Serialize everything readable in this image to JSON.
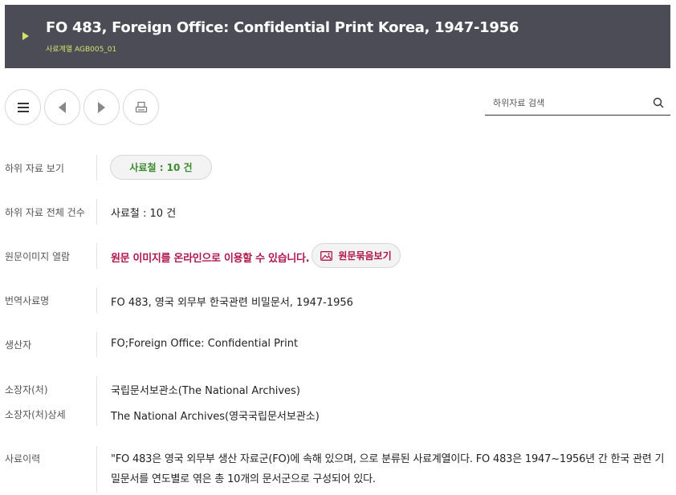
{
  "header": {
    "title": "FO 483, Foreign Office: Confidential Print Korea, 1947-1956",
    "subtitle": "사료계열 AGB005_01",
    "accent_color": "#d6e36b",
    "background_color": "#4c4c57"
  },
  "toolbar": {
    "menu_icon": "hamburger-menu-icon",
    "prev_icon": "triangle-left-icon",
    "next_icon": "triangle-right-icon",
    "print_icon": "print-icon"
  },
  "search": {
    "placeholder": "하위자료 검색",
    "value": "",
    "icon": "search-icon"
  },
  "fields": {
    "sub_items": {
      "label": "하위 자료 보기",
      "button": "사료철 : 10 건"
    },
    "total_count": {
      "label": "하위 자료 전체 건수",
      "value": "사료철 : 10 건"
    },
    "image_view": {
      "label": "원문이미지 열람",
      "notice": "원문 이미지를 온라인으로 이용할 수 있습니다.",
      "button": "원문묶음보기",
      "icon": "image-icon"
    },
    "translated_name": {
      "label": "번역사료명",
      "value": "FO 483, 영국 외무부 한국관련 비밀문서, 1947-1956"
    },
    "creator": {
      "label": "생산자",
      "value": "FO;Foreign Office: Confidential Print"
    },
    "holder": {
      "label": "소장자(처)",
      "value": "국립문서보관소(The National Archives)"
    },
    "holder_detail": {
      "label": "소장자(처)상세",
      "value": "The National Archives(영국국립문서보관소)"
    },
    "history": {
      "label": "사료이력",
      "value": "\"FO 483은 영국 외무부 생산 자료군(FO)에 속해 있으며, 으로 분류된 사료계열이다. FO 483은 1947~1956년 간 한국 관련 기밀문서를 연도별로 엮은 총 10개의 문서군으로 구성되어 있다."
    }
  },
  "colors": {
    "link_green": "#3c8a2e",
    "notice_red": "#b0164a"
  }
}
